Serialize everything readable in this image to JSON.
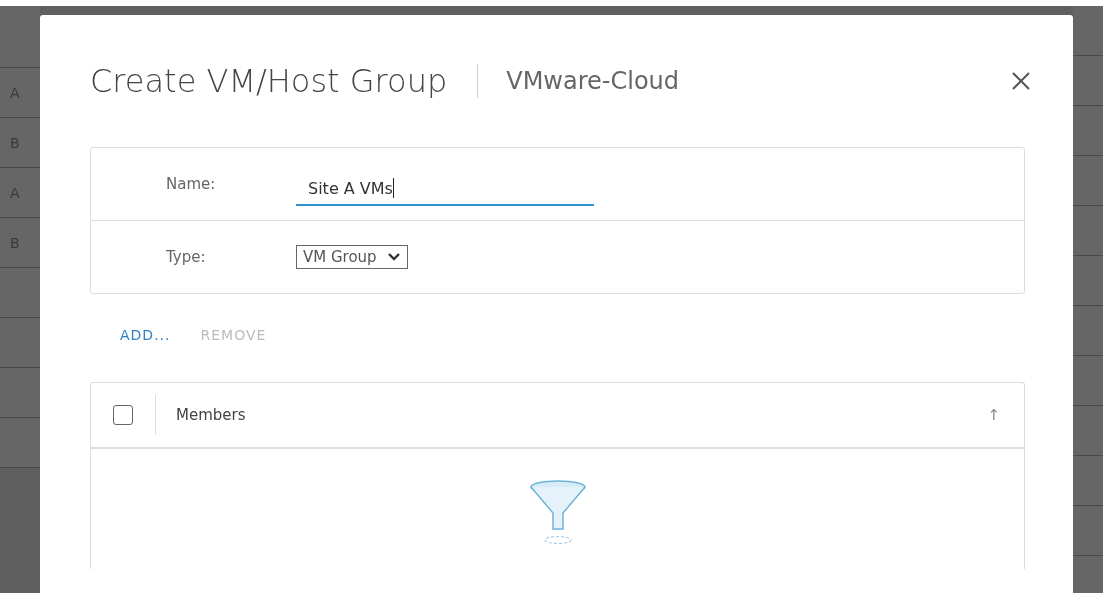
{
  "backdrop": {
    "row_labels": [
      "A",
      "B",
      "A",
      "B"
    ]
  },
  "dialog": {
    "title": "Create VM/Host Group",
    "subtitle": "VMware-Cloud",
    "fields": [
      {
        "kind": "text",
        "label": "Name:",
        "value": "Site A VMs",
        "focused": true
      },
      {
        "kind": "select",
        "label": "Type:",
        "value": "VM Group"
      }
    ],
    "actions": [
      {
        "label": "ADD...",
        "disabled": false
      },
      {
        "label": "REMOVE",
        "disabled": true
      }
    ],
    "table": {
      "select_all_checked": false,
      "columns": [
        {
          "label": "Members",
          "sort_indicator": "↑"
        }
      ]
    }
  }
}
